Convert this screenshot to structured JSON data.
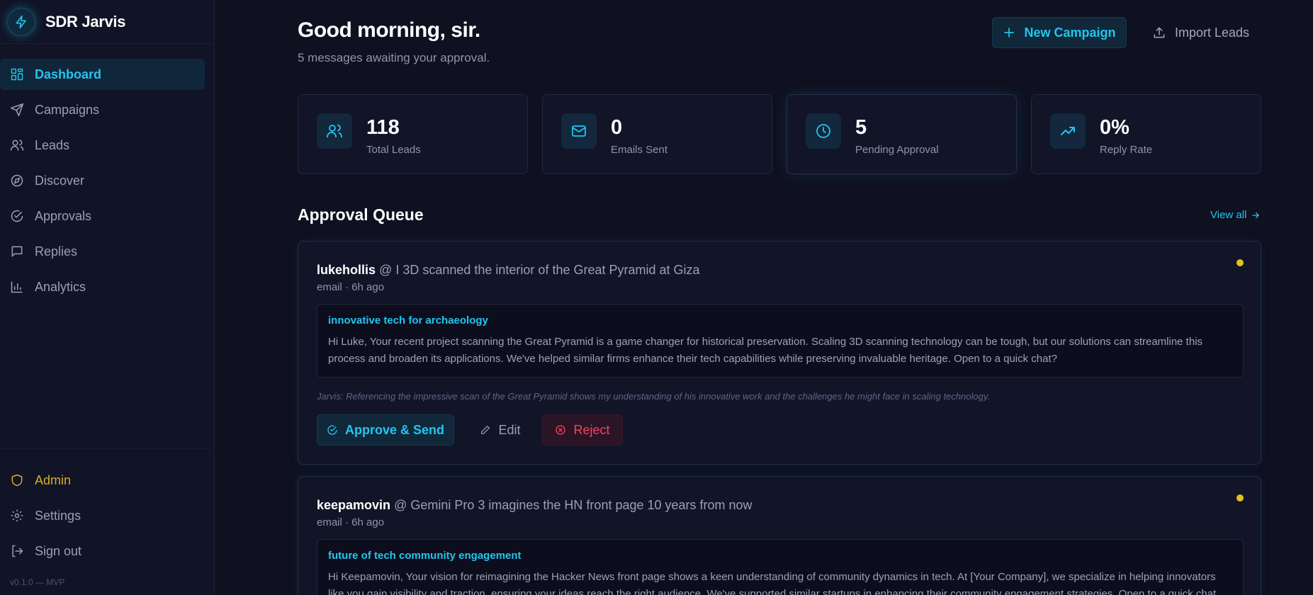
{
  "app": {
    "name": "SDR Jarvis",
    "version": "v0.1.0 — MVP"
  },
  "colors": {
    "accent": "#22c5ee",
    "admin": "#d6b022",
    "danger": "#f0455d",
    "pending_dot": "#e6c01c"
  },
  "sidebar": {
    "items": [
      {
        "label": "Dashboard",
        "icon": "dashboard-icon",
        "active": true
      },
      {
        "label": "Campaigns",
        "icon": "send-icon"
      },
      {
        "label": "Leads",
        "icon": "users-icon"
      },
      {
        "label": "Discover",
        "icon": "compass-icon"
      },
      {
        "label": "Approvals",
        "icon": "check-circle-icon"
      },
      {
        "label": "Replies",
        "icon": "message-icon"
      },
      {
        "label": "Analytics",
        "icon": "bar-chart-icon"
      }
    ],
    "bottom": [
      {
        "label": "Admin",
        "icon": "shield-icon"
      },
      {
        "label": "Settings",
        "icon": "gear-icon"
      },
      {
        "label": "Sign out",
        "icon": "logout-icon"
      }
    ]
  },
  "header": {
    "greeting": "Good morning, sir.",
    "subtitle": "5 messages awaiting your approval.",
    "new_campaign": "New Campaign",
    "import_leads": "Import Leads"
  },
  "stats": [
    {
      "value": "118",
      "label": "Total Leads",
      "icon": "users-icon"
    },
    {
      "value": "0",
      "label": "Emails Sent",
      "icon": "mail-icon"
    },
    {
      "value": "5",
      "label": "Pending Approval",
      "icon": "clock-icon"
    },
    {
      "value": "0%",
      "label": "Reply Rate",
      "icon": "trending-up-icon"
    }
  ],
  "queue": {
    "title": "Approval Queue",
    "view_all": "View all",
    "items": [
      {
        "author": "lukehollis",
        "post": "@ I 3D scanned the interior of the Great Pyramid at Giza",
        "meta": "email · 6h ago",
        "subject": "innovative tech for archaeology",
        "body": "Hi Luke, Your recent project scanning the Great Pyramid is a game changer for historical preservation. Scaling 3D scanning technology can be tough, but our solutions can streamline this process and broaden its applications. We've helped similar firms enhance their tech capabilities while preserving invaluable heritage. Open to a quick chat?",
        "reasoning": "Jarvis: Referencing the impressive scan of the Great Pyramid shows my understanding of his innovative work and the challenges he might face in scaling technology.",
        "approve": "Approve & Send",
        "edit": "Edit",
        "reject": "Reject"
      },
      {
        "author": "keepamovin",
        "post": "@ Gemini Pro 3 imagines the HN front page 10 years from now",
        "meta": "email · 6h ago",
        "subject": "future of tech community engagement",
        "body": "Hi Keepamovin, Your vision for reimagining the Hacker News front page shows a keen understanding of community dynamics in tech. At [Your Company], we specialize in helping innovators like you gain visibility and traction, ensuring your ideas reach the right audience. We've supported similar startups in enhancing their community engagement strategies. Open to a quick chat this"
      }
    ]
  }
}
